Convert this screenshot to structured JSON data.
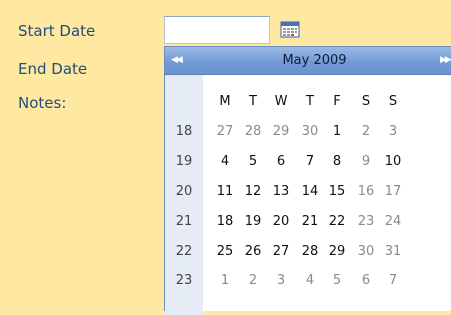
{
  "form": {
    "start_label": "Start Date",
    "end_label": "End Date",
    "notes_label": "Notes:",
    "start_value": ""
  },
  "calendar": {
    "title": "May 2009",
    "prev_glyph": "◀◀",
    "next_glyph": "▶▶",
    "weekdays": [
      "M",
      "T",
      "W",
      "T",
      "F",
      "S",
      "S"
    ],
    "weeks": [
      {
        "week": "18",
        "days": [
          [
            "27",
            true
          ],
          [
            "28",
            true
          ],
          [
            "29",
            true
          ],
          [
            "30",
            true
          ],
          [
            "1",
            false
          ],
          [
            "2",
            true
          ],
          [
            "3",
            true
          ]
        ]
      },
      {
        "week": "19",
        "days": [
          [
            "4",
            false
          ],
          [
            "5",
            false
          ],
          [
            "6",
            false
          ],
          [
            "7",
            false
          ],
          [
            "8",
            false
          ],
          [
            "9",
            true
          ],
          [
            "10",
            false
          ]
        ]
      },
      {
        "week": "20",
        "days": [
          [
            "11",
            false
          ],
          [
            "12",
            false
          ],
          [
            "13",
            false
          ],
          [
            "14",
            false
          ],
          [
            "15",
            false
          ],
          [
            "16",
            true
          ],
          [
            "17",
            true
          ]
        ]
      },
      {
        "week": "21",
        "days": [
          [
            "18",
            false
          ],
          [
            "19",
            false
          ],
          [
            "20",
            false
          ],
          [
            "21",
            false
          ],
          [
            "22",
            false
          ],
          [
            "23",
            true
          ],
          [
            "24",
            true
          ]
        ]
      },
      {
        "week": "22",
        "days": [
          [
            "25",
            false
          ],
          [
            "26",
            false
          ],
          [
            "27",
            false
          ],
          [
            "28",
            false
          ],
          [
            "29",
            false
          ],
          [
            "30",
            true
          ],
          [
            "31",
            true
          ]
        ]
      },
      {
        "week": "23",
        "days": [
          [
            "1",
            true
          ],
          [
            "2",
            true
          ],
          [
            "3",
            true
          ],
          [
            "4",
            true
          ],
          [
            "5",
            true
          ],
          [
            "6",
            true
          ],
          [
            "7",
            true
          ]
        ]
      }
    ]
  },
  "icons": {
    "calendar_button": "calendar-icon"
  },
  "colors": {
    "page_bg": "#ffe8a1",
    "label_text": "#1f4e79",
    "header_blue": "#739ad6",
    "week_col_bg": "#e6ecf3",
    "other_month_text": "#8a8a8a"
  }
}
